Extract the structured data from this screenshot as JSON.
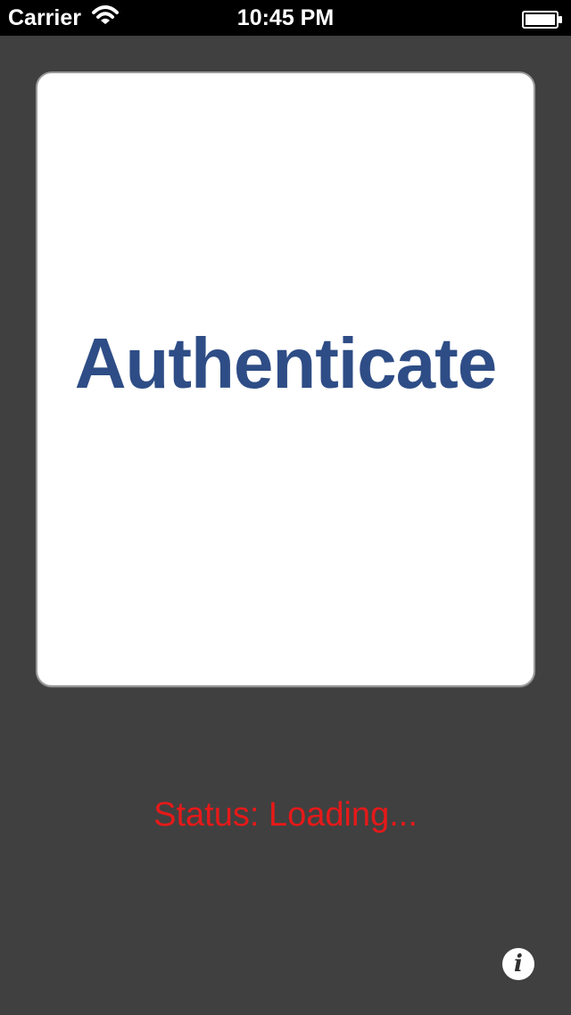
{
  "status_bar": {
    "carrier": "Carrier",
    "time": "10:45 PM",
    "wifi_icon": "wifi-icon",
    "battery_icon": "battery-icon"
  },
  "main": {
    "auth_button_label": "Authenticate",
    "status_text": "Status: Loading...",
    "info_icon": "info-icon",
    "info_glyph": "i"
  },
  "colors": {
    "app_background": "#404040",
    "card_background": "#ffffff",
    "authenticate_text": "#2e4d86",
    "status_text": "#e61919",
    "info_button": "#ffffff"
  }
}
